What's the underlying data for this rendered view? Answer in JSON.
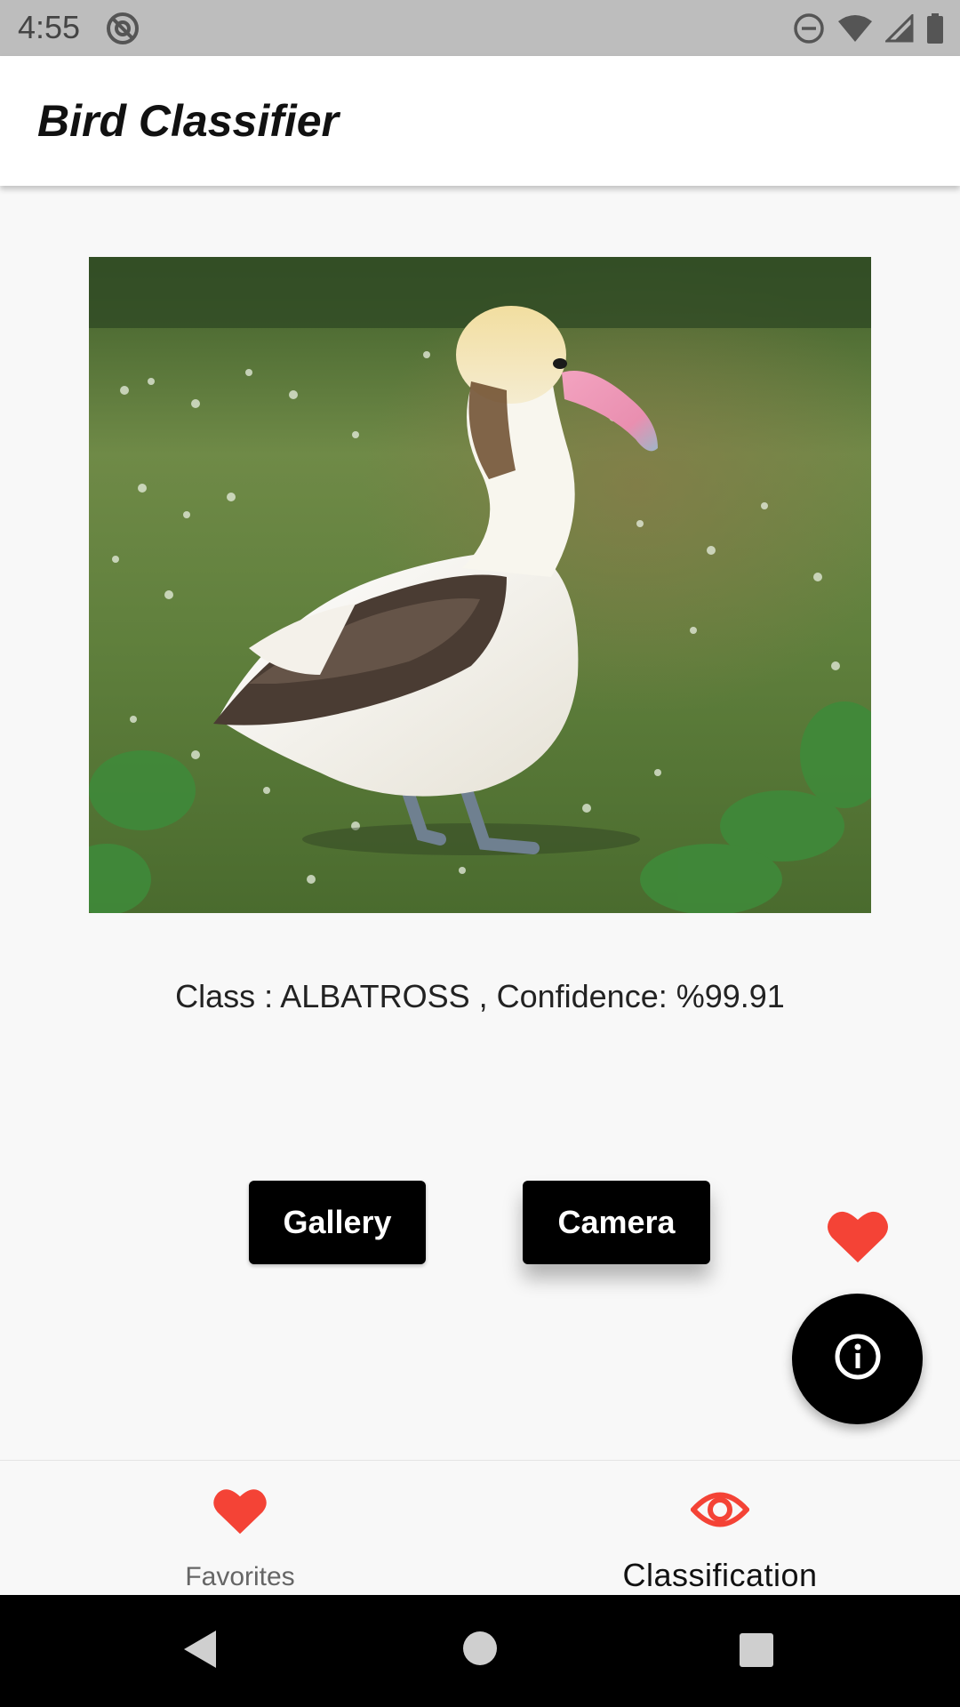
{
  "status_bar": {
    "time": "4:55",
    "icons": [
      "sync-disabled-icon",
      "do-not-disturb-icon",
      "wifi-icon",
      "signal-icon",
      "battery-icon"
    ]
  },
  "app_bar": {
    "title": "Bird Classifier"
  },
  "photo": {
    "subject": "bird-photo"
  },
  "result": {
    "text": "Class : ALBATROSS , Confidence: %99.91"
  },
  "buttons": {
    "gallery_label": "Gallery",
    "camera_label": "Camera"
  },
  "favorite": {
    "icon": "heart-icon",
    "color": "#f44336"
  },
  "fab": {
    "icon": "info-icon"
  },
  "bottom_nav": {
    "items": [
      {
        "label": "Favorites",
        "icon": "heart-icon",
        "active": false
      },
      {
        "label": "Classification",
        "icon": "eye-icon",
        "active": true
      }
    ],
    "accent": "#f44336"
  },
  "system_nav": {
    "buttons": [
      "back-icon",
      "home-icon",
      "recents-icon"
    ]
  }
}
